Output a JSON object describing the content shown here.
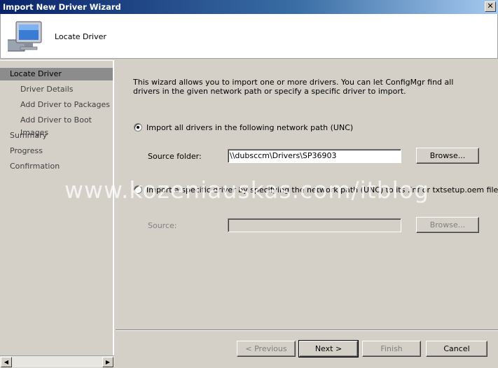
{
  "window": {
    "title": "Import New Driver Wizard",
    "close_glyph": "✕"
  },
  "header": {
    "title": "Locate Driver",
    "icon": "computer-monitor-icon"
  },
  "sidebar": {
    "items": [
      {
        "label": "Locate Driver",
        "active": true
      },
      {
        "label": "Driver Details",
        "indent": true
      },
      {
        "label": "Add Driver to Packages",
        "indent": true
      },
      {
        "label": "Add Driver to Boot Images",
        "indent": true
      },
      {
        "label": "Summary"
      },
      {
        "label": "Progress"
      },
      {
        "label": "Confirmation"
      }
    ]
  },
  "content": {
    "description": "This wizard allows you to import one or more drivers. You can let ConfigMgr find all drivers in the given network path or specify a specific driver to import.",
    "option1": {
      "label": "Import all drivers in the following network path (UNC)",
      "checked": true
    },
    "source_folder": {
      "label": "Source folder:",
      "value": "\\\\dubsccm\\Drivers\\SP36903"
    },
    "browse1": "Browse...",
    "option2": {
      "label": "Import a specific driver by specifying the network path (UNC) to its .inf or txtsetup.oem file",
      "checked": false
    },
    "source": {
      "label": "Source:",
      "value": ""
    },
    "browse2": "Browse..."
  },
  "watermark": "www.kozeniauskas.com/itblog",
  "buttons": {
    "previous": "< Previous",
    "next": "Next >",
    "finish": "Finish",
    "cancel": "Cancel"
  },
  "scrollbar": {
    "left": "◀",
    "right": "▶"
  }
}
